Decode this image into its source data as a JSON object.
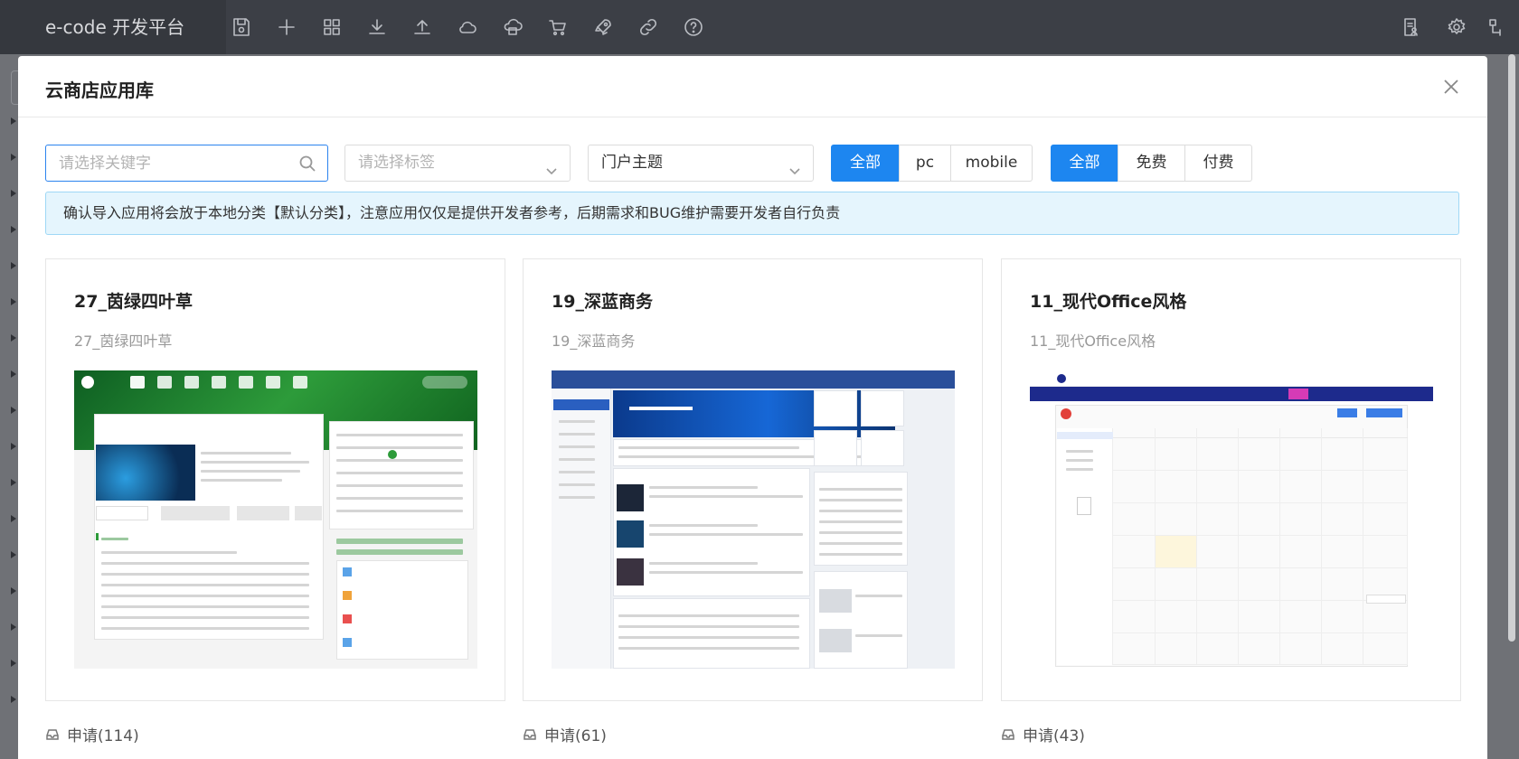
{
  "app": {
    "brand": "e-code 开发平台"
  },
  "toolbar": {
    "tools": [
      {
        "name": "save-icon"
      },
      {
        "name": "plus-icon"
      },
      {
        "name": "grid-icon"
      },
      {
        "name": "download-icon"
      },
      {
        "name": "upload-icon"
      },
      {
        "name": "cloud-icon"
      },
      {
        "name": "cloud-store-icon"
      },
      {
        "name": "cart-icon"
      },
      {
        "name": "rocket-icon"
      },
      {
        "name": "link-icon"
      },
      {
        "name": "help-icon"
      }
    ],
    "right_tools": [
      {
        "name": "doc-user-icon"
      },
      {
        "name": "gear-icon"
      },
      {
        "name": "flow-icon"
      }
    ]
  },
  "modal": {
    "title": "云商店应用库",
    "search": {
      "placeholder": "请选择关键字"
    },
    "tag_select": {
      "placeholder": "请选择标签"
    },
    "theme_select": {
      "value": "门户主题"
    },
    "platform_filter": {
      "options": [
        "全部",
        "pc",
        "mobile"
      ],
      "active": "全部"
    },
    "price_filter": {
      "options": [
        "全部",
        "免费",
        "付费"
      ],
      "active": "全部"
    },
    "notice": "确认导入应用将会放于本地分类【默认分类】，注意应用仅仅是提供开发者参考，后期需求和BUG维护需要开发者自行负责",
    "cards": [
      {
        "title": "27_茵绿四叶草",
        "subtitle": "27_茵绿四叶草",
        "apply": "申请(114)"
      },
      {
        "title": "19_深蓝商务",
        "subtitle": "19_深蓝商务",
        "apply": "申请(61)"
      },
      {
        "title": "11_现代Office风格",
        "subtitle": "11_现代Office风格",
        "apply": "申请(43)"
      }
    ]
  },
  "colors": {
    "primary": "#1d86f0",
    "topbar": "#3c3f46",
    "notice_bg": "#e5f5fd"
  }
}
